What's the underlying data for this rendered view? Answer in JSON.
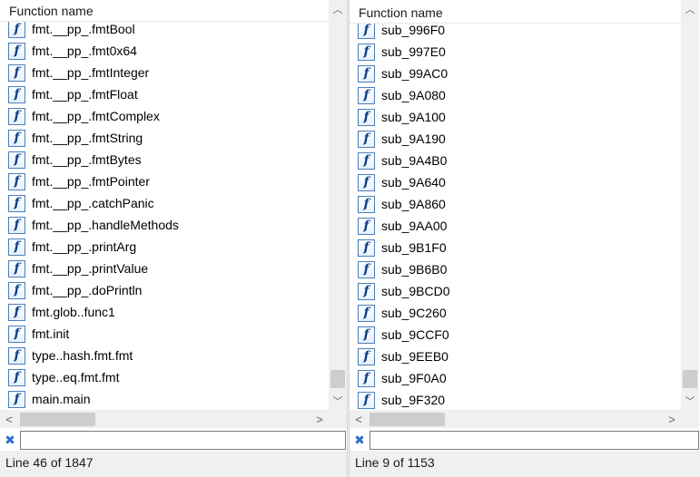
{
  "left_pane": {
    "header": "Function name",
    "rows": [
      {
        "label": "fmt.__pp_.fmtBool"
      },
      {
        "label": "fmt.__pp_.fmt0x64"
      },
      {
        "label": "fmt.__pp_.fmtInteger"
      },
      {
        "label": "fmt.__pp_.fmtFloat"
      },
      {
        "label": "fmt.__pp_.fmtComplex"
      },
      {
        "label": "fmt.__pp_.fmtString"
      },
      {
        "label": "fmt.__pp_.fmtBytes"
      },
      {
        "label": "fmt.__pp_.fmtPointer"
      },
      {
        "label": "fmt.__pp_.catchPanic"
      },
      {
        "label": "fmt.__pp_.handleMethods"
      },
      {
        "label": "fmt.__pp_.printArg"
      },
      {
        "label": "fmt.__pp_.printValue"
      },
      {
        "label": "fmt.__pp_.doPrintln"
      },
      {
        "label": "fmt.glob..func1"
      },
      {
        "label": "fmt.init"
      },
      {
        "label": "type..hash.fmt.fmt"
      },
      {
        "label": "type..eq.fmt.fmt"
      },
      {
        "label": "main.main"
      }
    ],
    "filter_value": "",
    "status": "Line 46 of 1847"
  },
  "right_pane": {
    "header": "Function name",
    "rows": [
      {
        "label": "sub_996F0"
      },
      {
        "label": "sub_997E0"
      },
      {
        "label": "sub_99AC0"
      },
      {
        "label": "sub_9A080"
      },
      {
        "label": "sub_9A100"
      },
      {
        "label": "sub_9A190"
      },
      {
        "label": "sub_9A4B0"
      },
      {
        "label": "sub_9A640"
      },
      {
        "label": "sub_9A860"
      },
      {
        "label": "sub_9AA00"
      },
      {
        "label": "sub_9B1F0"
      },
      {
        "label": "sub_9B6B0"
      },
      {
        "label": "sub_9BCD0"
      },
      {
        "label": "sub_9C260"
      },
      {
        "label": "sub_9CCF0"
      },
      {
        "label": "sub_9EEB0"
      },
      {
        "label": "sub_9F0A0"
      },
      {
        "label": "sub_9F320"
      }
    ],
    "filter_value": "",
    "status": "Line 9 of 1153"
  },
  "icons": {
    "function": "f",
    "clear": "✖",
    "up": "▲",
    "down": "▼",
    "left": "<",
    "right": ">"
  }
}
